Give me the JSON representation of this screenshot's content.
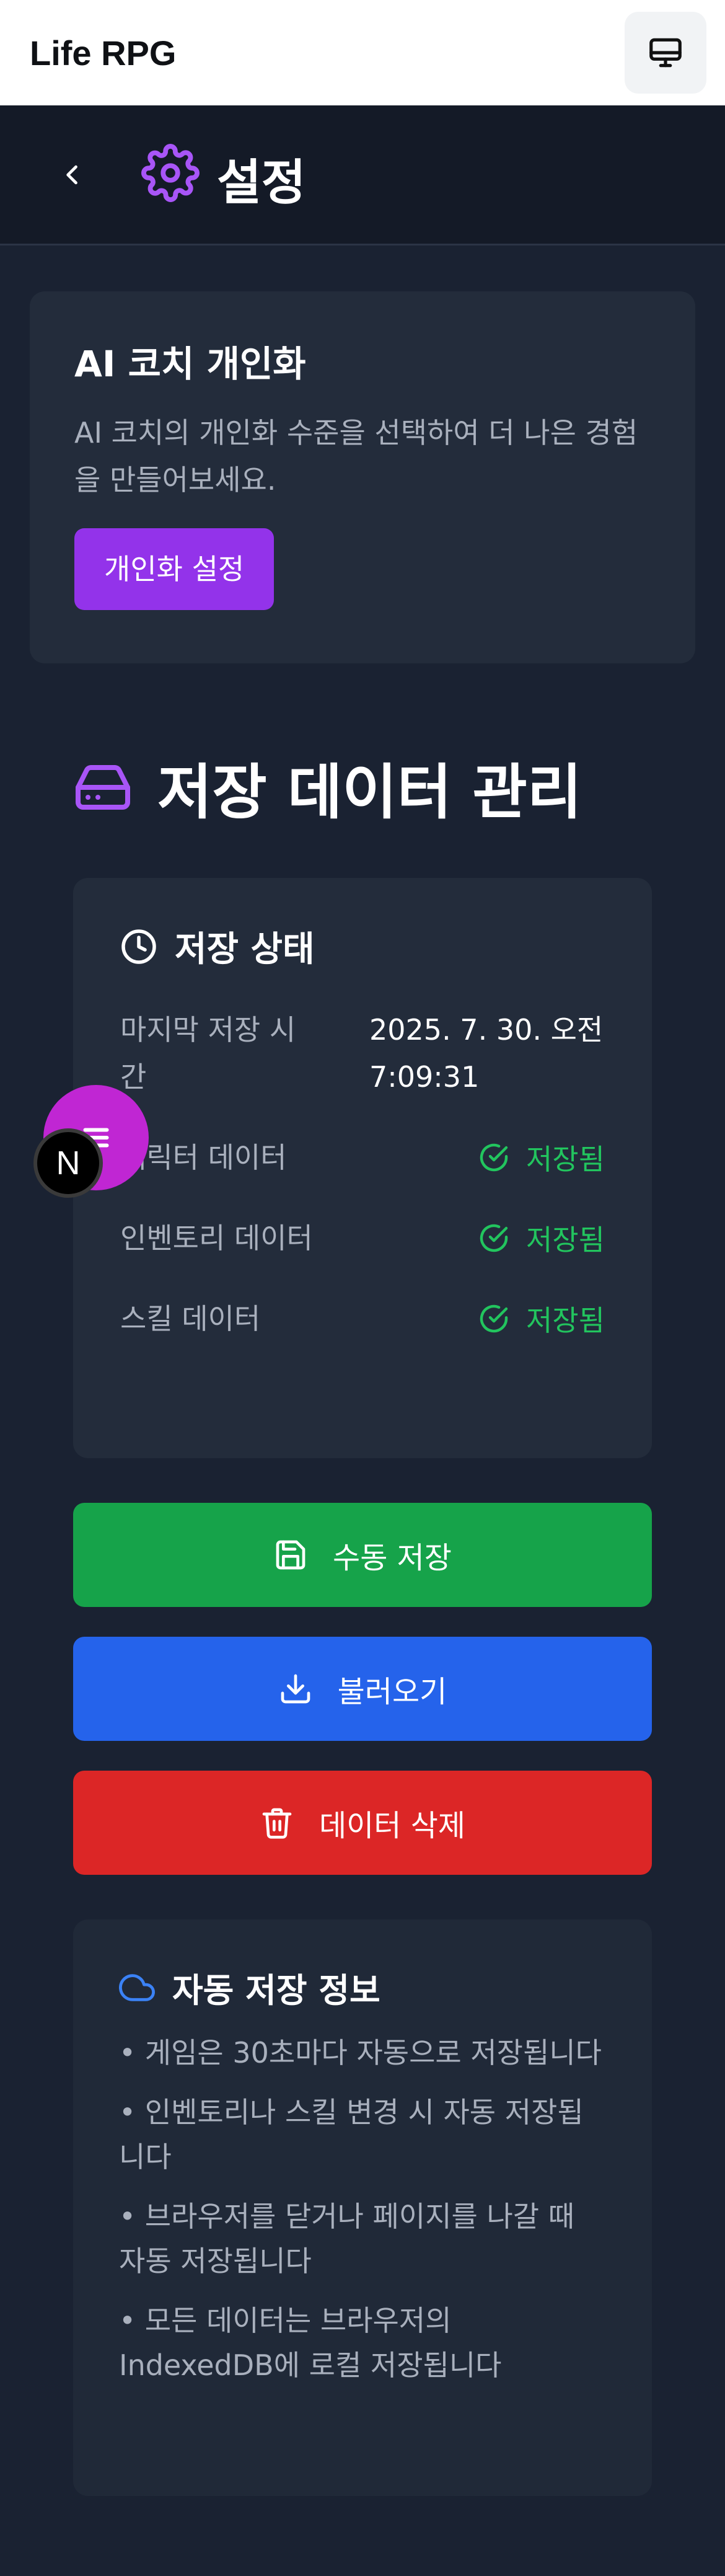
{
  "app": {
    "title": "Life RPG"
  },
  "header": {
    "title": "설정"
  },
  "ai_card": {
    "title": "AI 코치 개인화",
    "description": "AI 코치의 개인화 수준을 선택하여 더 나은 경험을 만들어보세요.",
    "button": "개인화 설정"
  },
  "data_section": {
    "title": "저장 데이터 관리",
    "status": {
      "title": "저장 상태",
      "last_saved_label": "마지막 저장 시간",
      "last_saved_value": "2025. 7. 30. 오전 7:09:31",
      "items": [
        {
          "label": "캐릭터 데이터",
          "status": "저장됨"
        },
        {
          "label": "인벤토리 데이터",
          "status": "저장됨"
        },
        {
          "label": "스킬 데이터",
          "status": "저장됨"
        }
      ]
    },
    "actions": {
      "save": "수동 저장",
      "load": "불러오기",
      "delete": "데이터 삭제"
    },
    "auto": {
      "title": "자동 저장 정보",
      "items": [
        "• 게임은 30초마다 자동으로 저장됩니다",
        "• 인벤토리나 스킬 변경 시 자동 저장됩니다",
        "• 브라우저를 닫거나 페이지를 나갈 때 자동 저장됩니다",
        "• 모든 데이터는 브라우저의 IndexedDB에 로컬 저장됩니다"
      ]
    }
  },
  "overlay": {
    "next_badge": "N"
  },
  "colors": {
    "accent_purple": "#9333ea",
    "success_green": "#22c55e",
    "save_green": "#16a34a",
    "load_blue": "#2563eb",
    "delete_red": "#dc2626"
  }
}
